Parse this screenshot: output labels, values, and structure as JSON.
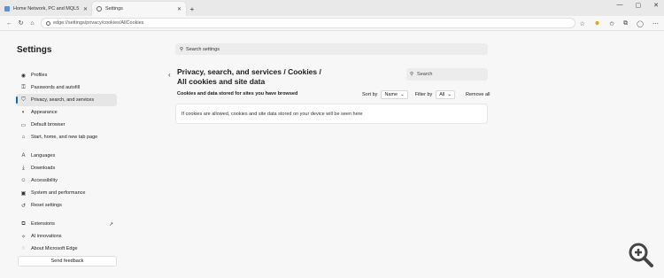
{
  "browser": {
    "tabs": [
      {
        "title": "Home Network, PC and MQL5 Co...",
        "active": false,
        "favicon_color": "#5b8fd6"
      },
      {
        "title": "Settings",
        "active": true,
        "favicon_color": "#666666"
      }
    ],
    "new_tab_glyph": "+",
    "window_controls": {
      "minimize": "—",
      "maximize": "▢",
      "close": "✕"
    },
    "address": "edge://settings/privacy/cookies/AllCookies",
    "toolbar_icons": [
      "star-icon",
      "emoji-icon",
      "favorites-icon",
      "collections-icon",
      "profile-icon",
      "menu-icon"
    ]
  },
  "settings": {
    "title": "Settings",
    "search_placeholder": "Search settings",
    "nav": [
      {
        "label": "Profiles",
        "icon": "◉",
        "name": "profiles"
      },
      {
        "label": "Passwords and autofill",
        "icon": "⚿",
        "name": "passwords"
      },
      {
        "label": "Privacy, search, and services",
        "icon": "⛉",
        "name": "privacy",
        "selected": true
      },
      {
        "label": "Appearance",
        "icon": "◐",
        "name": "appearance"
      },
      {
        "label": "Default browser",
        "icon": "▭",
        "name": "default-browser"
      },
      {
        "label": "Start, home, and new tab page",
        "icon": "⌂",
        "name": "start-home"
      },
      {
        "gap": true
      },
      {
        "label": "Languages",
        "icon": "A",
        "name": "languages"
      },
      {
        "label": "Downloads",
        "icon": "⤓",
        "name": "downloads"
      },
      {
        "label": "Accessibility",
        "icon": "☺",
        "name": "accessibility"
      },
      {
        "label": "System and performance",
        "icon": "▣",
        "name": "system"
      },
      {
        "label": "Reset settings",
        "icon": "↺",
        "name": "reset"
      },
      {
        "gap": true
      },
      {
        "label": "Extensions",
        "icon": "⧉",
        "name": "extensions",
        "external": "↗"
      },
      {
        "label": "AI innovations",
        "icon": "✧",
        "name": "ai-innovations"
      },
      {
        "label": "About Microsoft Edge",
        "icon": "◌",
        "name": "about"
      }
    ],
    "feedback_label": "Send feedback"
  },
  "page": {
    "back_glyph": "‹",
    "heading_line1": "Privacy, search, and services / Cookies /",
    "heading_line2": "All cookies and site data",
    "search_placeholder": "Search",
    "subheading": "Cookies and data stored for sites you have browsed",
    "sort_label": "Sort by",
    "sort_value": "Name",
    "filter_label": "Filter by",
    "filter_value": "All",
    "remove_all": "Remove all",
    "empty_message": "If cookies are allowed, cookies and site data stored on your device will be seen here"
  }
}
